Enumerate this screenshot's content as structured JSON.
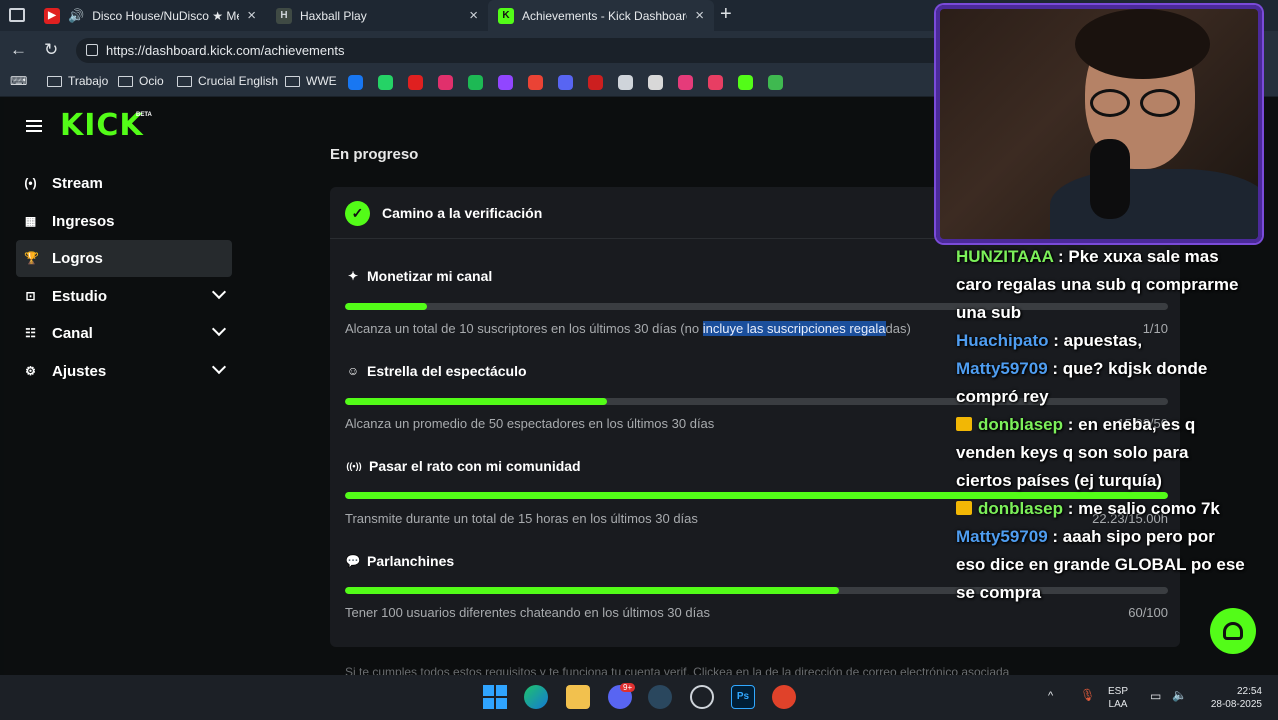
{
  "browser": {
    "tabs": [
      {
        "title": "Disco House/NuDisco ★ Mé",
        "fav_color": "#e02020"
      },
      {
        "title": "Haxball Play",
        "fav_color": "#3f4a44"
      },
      {
        "title": "Achievements - Kick Dashboard",
        "fav_color": "#53fc18"
      }
    ],
    "url": "https://dashboard.kick.com/achievements",
    "bookmarks": [
      "Trabajo",
      "Ocio",
      "Crucial English",
      "WWE"
    ],
    "bookmark_icon_colors": [
      "#1877f2",
      "#25d366",
      "#e02020",
      "#e1306c",
      "#1db954",
      "#9146ff",
      "#ea4335",
      "#5865f2",
      "#cc1f1f",
      "#cfd4da",
      "#d8d8d8",
      "#e53b7a",
      "#e83e63",
      "#53fc18",
      "#3fb950"
    ]
  },
  "kick": {
    "logo": "KICK",
    "beta": "BETA",
    "nav": [
      {
        "label": "Stream",
        "icon": "(•)",
        "expandable": false,
        "active": false
      },
      {
        "label": "Ingresos",
        "icon": "▦",
        "expandable": false,
        "active": false
      },
      {
        "label": "Logros",
        "icon": "🏆",
        "expandable": false,
        "active": true
      },
      {
        "label": "Estudio",
        "icon": "⊡",
        "expandable": true,
        "active": false
      },
      {
        "label": "Canal",
        "icon": "☷",
        "expandable": true,
        "active": false
      },
      {
        "label": "Ajustes",
        "icon": "⚙",
        "expandable": true,
        "active": false
      }
    ],
    "section_title": "En progreso",
    "card_title": "Camino a la verificación",
    "achievements": [
      {
        "name": "Monetizar mi canal",
        "icon": "✦",
        "desc_before": "Alcanza un total de 10 suscriptores en los últimos 30 días (no ",
        "desc_highlight": "incluye las suscripciones regala",
        "desc_after": "das)",
        "count": "1/10",
        "progress": 0.1
      },
      {
        "name": "Estrella del espectáculo",
        "icon": "☺",
        "desc_before": "Alcanza un promedio de 50 espectadores en los últimos 30 días",
        "desc_highlight": "",
        "desc_after": "",
        "count": "15.92/50",
        "progress": 0.318
      },
      {
        "name": "Pasar el rato con mi comunidad",
        "icon": "((•))",
        "desc_before": "Transmite durante un total de 15 horas en los últimos 30 días",
        "desc_highlight": "",
        "desc_after": "",
        "count": "22.23/15.00h",
        "progress": 1.0
      },
      {
        "name": "Parlanchines",
        "icon": "💬",
        "desc_before": "Tener 100 usuarios diferentes chateando en los últimos 30 días",
        "desc_highlight": "",
        "desc_after": "",
        "count": "60/100",
        "progress": 0.6
      }
    ],
    "footer": "Si te cumples todos estos requisitos y te funciona tu cuenta verif. Clickea en la de la dirección de correo electrónico asociada"
  },
  "chat": [
    {
      "user": "HUNZITAAA",
      "color": "#7cf05a",
      "badge": false,
      "text": "Pke xuxa sale mas caro regalas una sub q comprarme una sub"
    },
    {
      "user": "Huachipato",
      "color": "#4f9df0",
      "badge": false,
      "text": "apuestas,"
    },
    {
      "user": "Matty59709",
      "color": "#4f9df0",
      "badge": false,
      "text": "que? kdjsk donde compró rey"
    },
    {
      "user": "donblasep",
      "color": "#7cf05a",
      "badge": true,
      "text": "en eneba, es q venden keys q son solo para ciertos países (ej turquía)"
    },
    {
      "user": "donblasep",
      "color": "#7cf05a",
      "badge": true,
      "text": "me salio como 7k"
    },
    {
      "user": "Matty59709",
      "color": "#4f9df0",
      "badge": false,
      "text": "aaah sipo pero por eso dice en grande GLOBAL po ese se compra"
    }
  ],
  "taskbar": {
    "lang": "ESP",
    "layout": "LAA",
    "time": "22:54",
    "date": "28-08-2025",
    "discord_badge": "9+"
  }
}
